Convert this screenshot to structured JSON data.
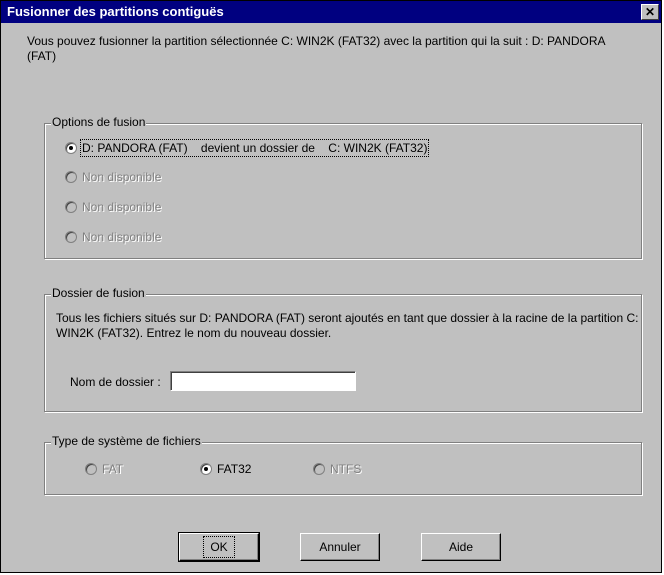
{
  "window": {
    "title": "Fusionner des partitions contiguës",
    "close_glyph": "✕"
  },
  "intro": {
    "text": "Vous pouvez fusionner la partition sélectionnée  C: WIN2K (FAT32)  avec la partition qui la suit :  D: PANDORA (FAT)"
  },
  "merge_options": {
    "legend": "Options de fusion",
    "options": [
      {
        "label": "D: PANDORA (FAT)    devient un dossier de    C: WIN2K (FAT32)",
        "checked": true,
        "enabled": true
      },
      {
        "label": "Non disponible",
        "checked": false,
        "enabled": false
      },
      {
        "label": "Non disponible",
        "checked": false,
        "enabled": false
      },
      {
        "label": "Non disponible",
        "checked": false,
        "enabled": false
      }
    ]
  },
  "merge_folder": {
    "legend": "Dossier de fusion",
    "description": "Tous les fichiers situés sur  D: PANDORA (FAT)  seront ajoutés en tant que dossier à la racine de la partition  C: WIN2K (FAT32). Entrez le nom du nouveau dossier.",
    "field_label": "Nom de dossier :",
    "field_value": ""
  },
  "filesystem": {
    "legend": "Type de système de fichiers",
    "options": [
      {
        "label": "FAT",
        "checked": false,
        "enabled": false
      },
      {
        "label": "FAT32",
        "checked": true,
        "enabled": true
      },
      {
        "label": "NTFS",
        "checked": false,
        "enabled": false
      }
    ]
  },
  "buttons": {
    "ok": "OK",
    "cancel": "Annuler",
    "help": "Aide"
  }
}
